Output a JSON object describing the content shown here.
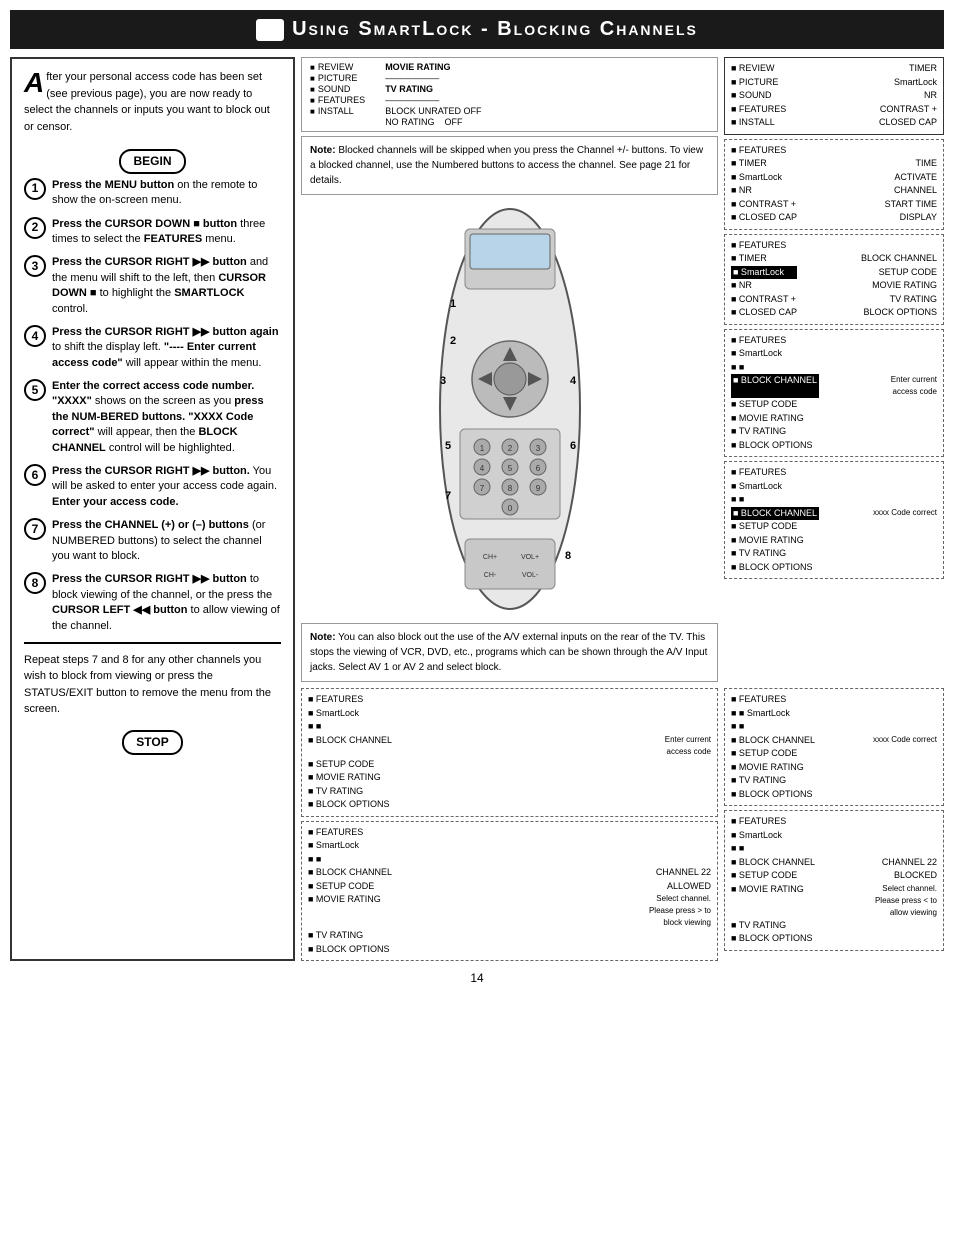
{
  "header": {
    "title": "Using SmartLock - Blocking Channels",
    "icon_label": "tv-icon"
  },
  "intro": {
    "drop_cap": "A",
    "text": "fter your personal access code has been set (see previous page), you are now ready to select the channels or inputs you want to block out or censor."
  },
  "begin_badge": "BEGIN",
  "stop_badge": "STOP",
  "steps": [
    {
      "num": "1",
      "text_html": "Press the MENU button on the remote to show the on-screen menu."
    },
    {
      "num": "2",
      "text_html": "Press the CURSOR DOWN ■ button three times to select the FEATURES menu."
    },
    {
      "num": "3",
      "text_html": "Press the CURSOR RIGHT ▶▶ button and the menu will shift to the left, then CURSOR DOWN ■ to highlight the SMARTLOCK control."
    },
    {
      "num": "4",
      "text_html": "Press the CURSOR RIGHT ▶▶ button again to shift the display left. \"---- Enter current access code\" will appear within the menu."
    },
    {
      "num": "5",
      "text_html": "Enter the correct access code number. \"XXXX\" shows on the screen as you press the NUMBERED buttons. \"XXXX Code correct\" will appear, then the BLOCK CHANNEL control will be highlighted."
    },
    {
      "num": "6",
      "text_html": "Press the CURSOR RIGHT ▶▶ button. You will be asked to enter your access code again. Enter your access code."
    },
    {
      "num": "7",
      "text_html": "Press the CHANNEL (+) or (–) buttons (or NUMBERED buttons) to select the channel you want to block."
    },
    {
      "num": "8",
      "text_html": "Press the CURSOR RIGHT ▶▶ button to block viewing of the channel, or the press the CURSOR LEFT ◀◀ button to allow viewing of the channel."
    }
  ],
  "repeat_text": "Repeat steps 7 and 8 for any other channels you wish to block from viewing or press the STATUS/EXIT button to remove the menu from the screen.",
  "note1": {
    "label": "Note:",
    "text": "Blocked channels will be skipped when you press the Channel +/- buttons. To view a blocked channel, use the Numbered buttons to access the channel. See page 21 for details."
  },
  "note2": {
    "label": "Note:",
    "text": "You can also block out the use of the A/V external inputs on the rear of the TV. This stops the viewing of VCR, DVD, etc., programs which can be shown through the A/V Input jacks. Select AV 1 or AV 2 and select block."
  },
  "tv_menu_initial": {
    "col1": [
      "■ REVIEW",
      "■ PICTURE",
      "■ SOUND",
      "■ FEATURES",
      "■ INSTALL"
    ],
    "col2_label": "MOVIE RATING",
    "col2_items": [
      "——————",
      "TV RATING",
      "——————",
      "BLOCK UNRATED OFF",
      "NO RATING    OFF"
    ]
  },
  "right_panels": [
    {
      "items": [
        "■ REVIEW",
        "■ PICTURE",
        "■ SOUND",
        "■ FEATURES",
        "■ INSTALL"
      ],
      "right_items": [
        "TIMER",
        "SmartLock",
        "NR",
        "CONTRAST +",
        "CLOSED CAP"
      ]
    },
    {
      "items": [
        "■ FEATURES",
        "■ TIMER",
        "■ SmartLock",
        "■ NR",
        "■ CONTRAST +",
        "■ CLOSED CAP"
      ],
      "right_items": [
        "",
        "TIME",
        "ACTIVATE",
        "CHANNEL",
        "START TIME",
        "DISPLAY"
      ]
    },
    {
      "items": [
        "■ FEATURES",
        "■ TIMER",
        "■ SmartLock",
        "■ NR",
        "■ CONTRAST +",
        "■ CLOSED CAP"
      ],
      "right_items": [
        "",
        "BLOCK CHANNEL",
        "SETUP CODE",
        "MOVIE RATING",
        "TV RATING",
        "BLOCK OPTIONS"
      ]
    },
    {
      "items": [
        "■ FEATURES",
        "■ SmartLock",
        "■ ■",
        "",
        "■ BLOCK CHANNEL",
        "■ SETUP CODE",
        "■ MOVIE RATING",
        "■ TV RATING",
        "■ BLOCK OPTIONS"
      ],
      "note": "Enter current access code"
    },
    {
      "items": [
        "■ FEATURES",
        "■ SmartLock",
        "■ ■",
        "",
        "■ BLOCK CHANNEL",
        "■ SETUP CODE",
        "■ MOVIE RATING",
        "■ TV RATING",
        "■ BLOCK OPTIONS"
      ],
      "right_note": "xxxx Code correct"
    }
  ],
  "bottom_left_panels": [
    {
      "type": "step5",
      "items": [
        "■ FEATURES",
        "■ SmartLock",
        "■ ■",
        "----",
        "■ BLOCK CHANNEL",
        "■ SETUP CODE",
        "■ MOVIE RATING",
        "■ TV RATING",
        "■ BLOCK OPTIONS"
      ],
      "note": "Enter current access code"
    },
    {
      "type": "step8_allowed",
      "items": [
        "■ FEATURES",
        "■ SmartLock",
        "■ ■",
        "",
        "■ BLOCK CHANNEL",
        "■ SETUP CODE",
        "■ MOVIE RATING",
        "■ TV RATING",
        "■ BLOCK OPTIONS"
      ],
      "channel": "CHANNEL 22",
      "status": "ALLOWED",
      "note": "Select channel. Please press > to block viewing"
    }
  ],
  "bottom_right_panels": [
    {
      "type": "step5_right",
      "items": [
        "■ FEATURES",
        "■ ■ SmartLock",
        "■ ■",
        "",
        "■ BLOCK CHANNEL",
        "■ SETUP CODE",
        "■ MOVIE RATING",
        "■ TV RATING",
        "■ BLOCK OPTIONS"
      ],
      "right_note": "xxxx Code correct"
    },
    {
      "type": "step8_blocked",
      "items": [
        "■ FEATURES",
        "■ SmartLock",
        "■ ■",
        "",
        "■ BLOCK CHANNEL",
        "■ SETUP CODE",
        "■ MOVIE RATING",
        "■ TV RATING",
        "■ BLOCK OPTIONS"
      ],
      "channel": "CHANNEL 22",
      "status": "BLOCKED",
      "note": "Select channel. Please press < to allow viewing"
    }
  ],
  "page_number": "14"
}
